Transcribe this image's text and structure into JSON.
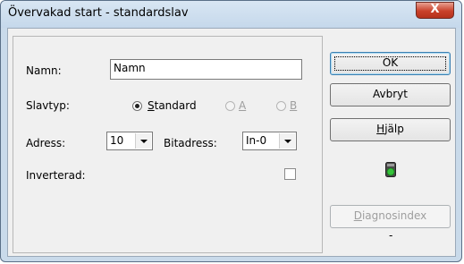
{
  "window": {
    "title": "Övervakad start - standardslav",
    "close_glyph": "X"
  },
  "form": {
    "name_label": "Namn:",
    "name_value": "Namn",
    "slavtyp_label": "Slavtyp:",
    "radio_standard": {
      "prefix": "",
      "hotkey": "S",
      "rest": "tandard",
      "selected": true
    },
    "radio_a": {
      "hotkey": "A",
      "selected": false,
      "enabled": false
    },
    "radio_b": {
      "hotkey": "B",
      "selected": false,
      "enabled": false
    },
    "adress_label": "Adress:",
    "adress_value": "10",
    "bitadress_label": "Bitadress:",
    "bitadress_value": "In-0",
    "inverterad_label": "Inverterad:",
    "inverterad_checked": false
  },
  "buttons": {
    "ok": "OK",
    "avbryt": "Avbryt",
    "hjalp_hotkey": "H",
    "hjalp_rest": "jälp",
    "diag_hotkey": "D",
    "diag_rest": "iagnosindex",
    "diag_status": "-"
  },
  "status_led": {
    "icon": "status-led-icon",
    "color": "#35c23a"
  }
}
